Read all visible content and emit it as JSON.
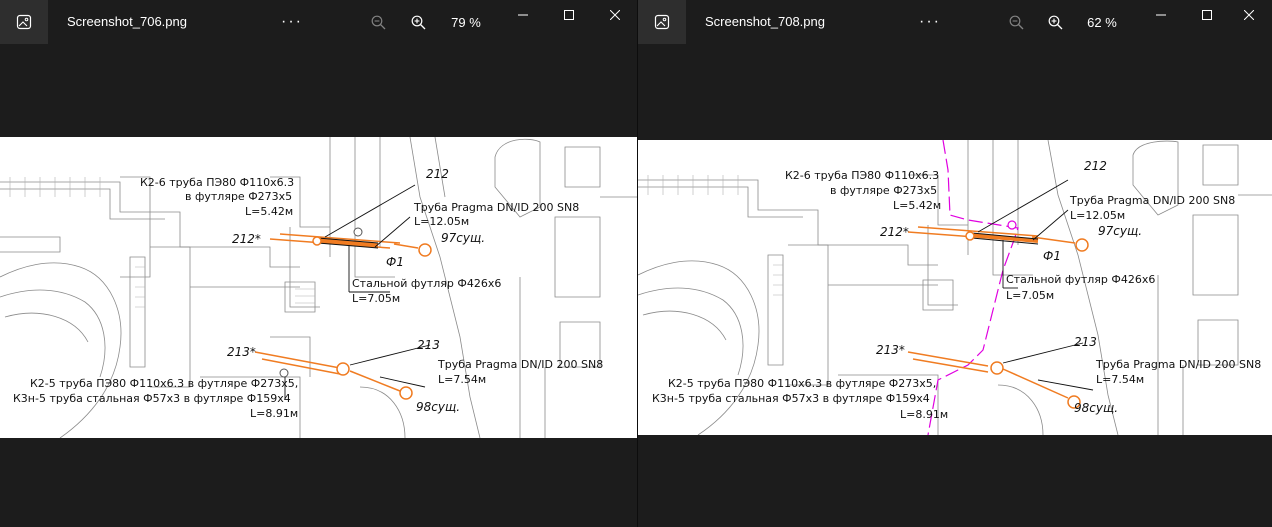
{
  "windows": [
    {
      "filename": "Screenshot_706.png",
      "more_label": "···",
      "zoom": "79 %",
      "drawing": {
        "label_k2_6_line1": "К2-6 труба ПЭ80 Ф110х6.3",
        "label_k2_6_line2": "в футляре Ф273х5",
        "label_k2_6_line3": "L=5.42м",
        "label_212": "212",
        "label_212star": "212*",
        "label_pragma_top": "Труба Pragma DN/ID 200 SN8",
        "label_pragma_top_len": "L=12.05м",
        "label_97": "97сущ.",
        "label_f1": "Ф1",
        "label_steel_case": "Стальной футляр Ф426х6",
        "label_steel_case_len": "L=7.05м",
        "label_213": "213",
        "label_213star": "213*",
        "label_pragma_bottom": "Труба Pragma DN/ID 200 SN8",
        "label_pragma_bottom_len": "L=7.54м",
        "label_k2_5": "К2-5 труба ПЭ80 Ф110х6.3 в футляре Ф273х5,",
        "label_k3n_5": "К3н-5 труба стальная Ф57х3 в футляре Ф159х4",
        "label_bottom_len": "L=8.91м",
        "label_98": "98сущ."
      }
    },
    {
      "filename": "Screenshot_708.png",
      "more_label": "···",
      "zoom": "62 %",
      "drawing": {
        "label_k2_6_line1": "К2-6 труба ПЭ80 Ф110х6.3",
        "label_k2_6_line2": "в футляре Ф273х5",
        "label_k2_6_line3": "L=5.42м",
        "label_212": "212",
        "label_212star": "212*",
        "label_pragma_top": "Труба Pragma DN/ID 200 SN8",
        "label_pragma_top_len": "L=12.05м",
        "label_97": "97сущ.",
        "label_f1": "Ф1",
        "label_steel_case": "Стальной футляр Ф426х6",
        "label_steel_case_len": "L=7.05м",
        "label_213": "213",
        "label_213star": "213*",
        "label_pragma_bottom": "Труба Pragma DN/ID 200 SN8",
        "label_pragma_bottom_len": "L=7.54м",
        "label_k2_5": "К2-5 труба ПЭ80 Ф110х6.3 в футляре Ф273х5,",
        "label_k3n_5": "К3н-5 труба стальная Ф57х3 в футляре Ф159х4",
        "label_bottom_len": "L=8.91м",
        "label_98": "98сущ."
      }
    }
  ],
  "icons": {
    "app": "image-icon",
    "zoom_out": "zoom-out-icon",
    "zoom_in": "zoom-in-icon",
    "minimize": "minimize-icon",
    "maximize": "maximize-icon",
    "close": "close-icon"
  },
  "colors": {
    "background": "#1c1c1c",
    "pipe_orange": "#f07c22",
    "magenta_line": "#e000e0",
    "drawing_gray": "#8a8a8a"
  }
}
